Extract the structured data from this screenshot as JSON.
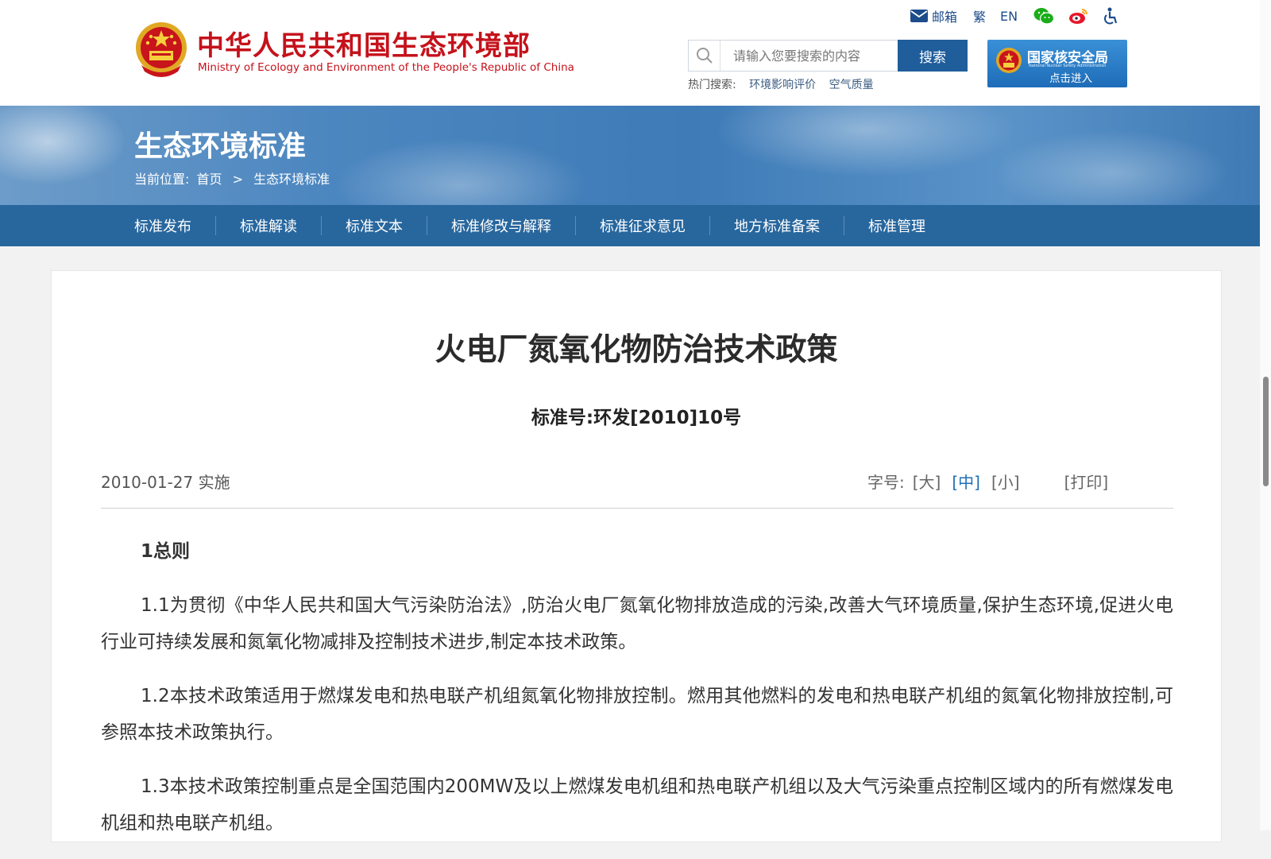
{
  "header": {
    "title_cn": "中华人民共和国生态环境部",
    "title_en": "Ministry of Ecology and Environment of the People's Republic of China",
    "top_links": [
      {
        "label": "邮箱",
        "icon": "mail-icon"
      },
      {
        "label": "繁",
        "icon": ""
      },
      {
        "label": "EN",
        "icon": ""
      },
      {
        "label": "",
        "icon": "wechat-icon"
      },
      {
        "label": "",
        "icon": "weibo-icon"
      },
      {
        "label": "",
        "icon": "accessibility-icon"
      }
    ],
    "search": {
      "placeholder": "请输入您要搜索的内容",
      "button_label": "搜索",
      "hot_label": "热门搜索:",
      "hot_items": [
        "环境影响评价",
        "空气质量"
      ]
    },
    "nnsa_banner": {
      "title": "国家核安全局",
      "subtitle": "National Nuclear Safety Administration",
      "enter_label": "点击进入"
    }
  },
  "banner": {
    "title": "生态环境标准",
    "breadcrumb_prefix": "当前位置:",
    "breadcrumb": [
      "首页",
      ">",
      "生态环境标准"
    ]
  },
  "nav": {
    "items": [
      "标准发布",
      "标准解读",
      "标准文本",
      "标准修改与解释",
      "标准征求意见",
      "地方标准备案",
      "标准管理"
    ]
  },
  "document": {
    "title": "火电厂氮氧化物防治技术政策",
    "number": "标准号:环发[2010]10号",
    "effective": "2010-01-27 实施",
    "font_size_label": "字号:",
    "font_size_options": [
      "[大]",
      "[中]",
      "[小]"
    ],
    "font_size_active": "[中]",
    "print_label": "[打印]",
    "section_head": "1总则",
    "paragraphs": [
      "1.1为贯彻《中华人民共和国大气污染防治法》,防治火电厂氮氧化物排放造成的污染,改善大气环境质量,保护生态环境,促进火电行业可持续发展和氮氧化物减排及控制技术进步,制定本技术政策。",
      "1.2本技术政策适用于燃煤发电和热电联产机组氮氧化物排放控制。燃用其他燃料的发电和热电联产机组的氮氧化物排放控制,可参照本技术政策执行。",
      "1.3本技术政策控制重点是全国范围内200MW及以上燃煤发电机组和热电联产机组以及大气污染重点控制区域内的所有燃煤发电机组和热电联产机组。"
    ]
  },
  "colors": {
    "brand_red": "#c5121b",
    "nav_blue": "#28679e",
    "search_blue": "#1f5d9b",
    "active_link": "#1f6fb5"
  }
}
